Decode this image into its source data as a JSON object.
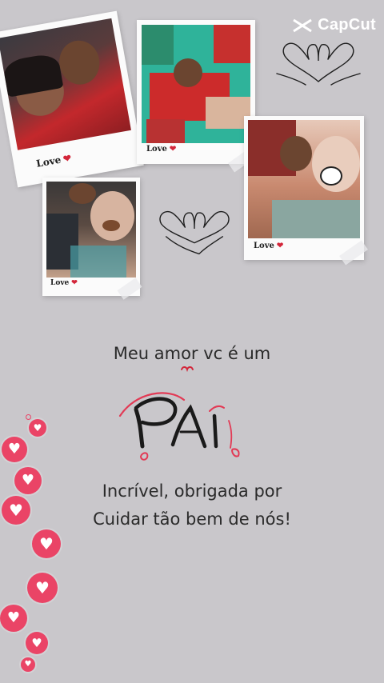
{
  "watermark": {
    "brand": "CapCut",
    "icon": "capcut-logo-icon"
  },
  "photos": [
    {
      "caption": "Love",
      "icon": "heart-icon"
    },
    {
      "caption": "Love",
      "icon": "heart-icon"
    },
    {
      "caption": "Love",
      "icon": "heart-icon"
    },
    {
      "caption": "Love",
      "icon": "heart-icon"
    }
  ],
  "message": {
    "line1": "Meu amor vc é um",
    "highlight": "Pai",
    "line2": "Incrível, obrigada por",
    "line3": "Cuidar tão bem de nós!"
  },
  "colors": {
    "background": "#c9c7cb",
    "heart": "#ea4466",
    "accent_red": "#d3263a"
  }
}
